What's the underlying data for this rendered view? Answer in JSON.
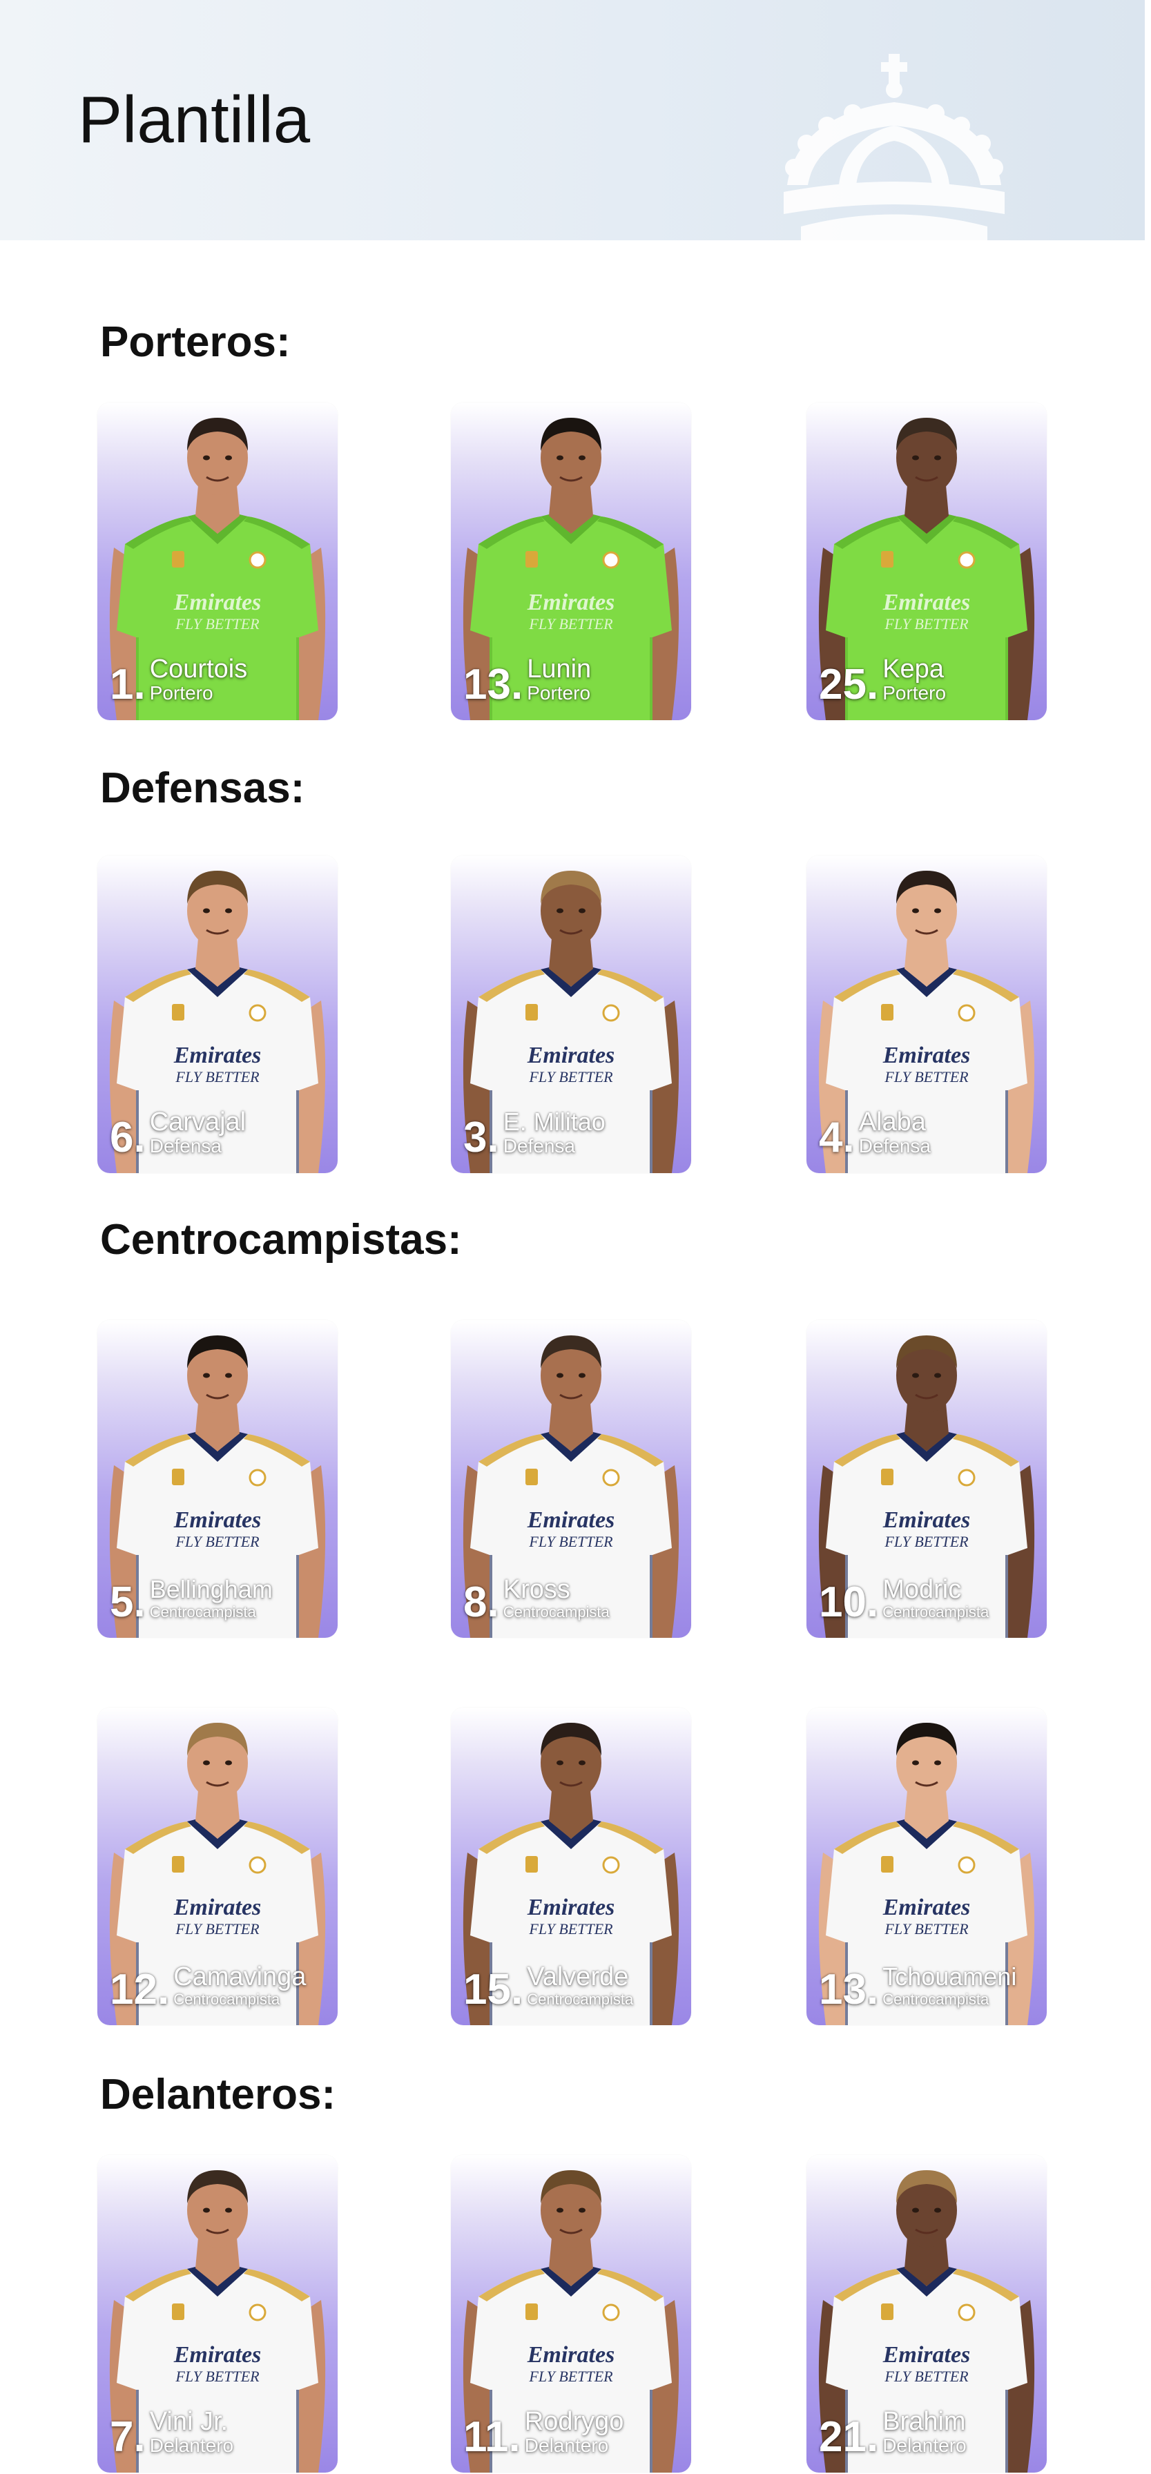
{
  "header": {
    "title": "Plantilla",
    "crest_icon": "real-madrid-crest-icon"
  },
  "colors": {
    "card_top": "#ffffff",
    "card_bottom": "#9a87e6",
    "goalkeeper_kit": "#7fdb44",
    "outfield_kit": "#f7f7f7",
    "kit_trim": "#1c2a5c",
    "kit_gold": "#d9a93a"
  },
  "sections": [
    {
      "title": "Porteros:",
      "players": [
        {
          "number": "1.",
          "name": "Courtois",
          "role": "Portero",
          "kit": "goalkeeper"
        },
        {
          "number": "13.",
          "name": "Lunin",
          "role": "Portero",
          "kit": "goalkeeper"
        },
        {
          "number": "25.",
          "name": "Kepa",
          "role": "Portero",
          "kit": "goalkeeper"
        }
      ]
    },
    {
      "title": "Defensas:",
      "players": [
        {
          "number": "6.",
          "name": "Carvajal",
          "role": "Defensa",
          "kit": "outfield"
        },
        {
          "number": "3.",
          "name": "E. Militao",
          "role": "Defensa",
          "kit": "outfield"
        },
        {
          "number": "4.",
          "name": "Alaba",
          "role": "Defensa",
          "kit": "outfield"
        }
      ]
    },
    {
      "title": "Centrocampistas:",
      "players": [
        {
          "number": "5.",
          "name": "Bellingham",
          "role": "Centrocampista",
          "kit": "outfield"
        },
        {
          "number": "8.",
          "name": "Kross",
          "role": "Centrocampista",
          "kit": "outfield"
        },
        {
          "number": "10.",
          "name": "Modric",
          "role": "Centrocampista",
          "kit": "outfield"
        },
        {
          "number": "12.",
          "name": "Camavinga",
          "role": "Centrocampista",
          "kit": "outfield"
        },
        {
          "number": "15.",
          "name": "Valverde",
          "role": "Centrocampista",
          "kit": "outfield"
        },
        {
          "number": "13.",
          "name": "Tchouameni",
          "role": "Centrocampista",
          "kit": "outfield"
        }
      ]
    },
    {
      "title": "Delanteros:",
      "players": [
        {
          "number": "7.",
          "name": "Vini Jr.",
          "role": "Delantero",
          "kit": "outfield"
        },
        {
          "number": "11.",
          "name": "Rodrygo",
          "role": "Delantero",
          "kit": "outfield"
        },
        {
          "number": "21.",
          "name": "Brahim",
          "role": "Delantero",
          "kit": "outfield"
        }
      ]
    }
  ]
}
